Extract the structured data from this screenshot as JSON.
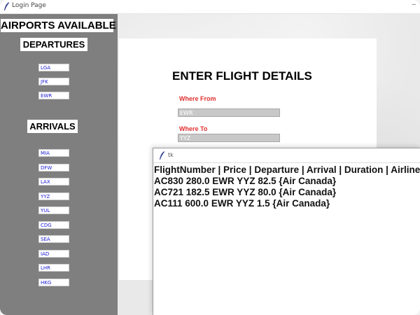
{
  "window": {
    "title": "Login Page",
    "minimize_glyph": "–",
    "icon": "feather-icon"
  },
  "sidebar": {
    "heading": "AIRPORTS AVAILABLE",
    "departures_heading": "DEPARTURES",
    "departures": [
      "LGA",
      "JFK",
      "EWR"
    ],
    "arrivals_heading": "ARRIVALS",
    "arrivals": [
      "MIA",
      "DFW",
      "LAX",
      "YYZ",
      "YUL",
      "CDG",
      "SEA",
      "IAD",
      "LHR",
      "HKG"
    ]
  },
  "form": {
    "title": "ENTER FLIGHT DETAILS",
    "from_label": "Where From",
    "from_value": "EWR",
    "to_label": "Where To",
    "to_value": "YYZ"
  },
  "results_window": {
    "title": "tk",
    "icon": "feather-icon",
    "lines": [
      "FlightNumber | Price | Departure | Arrival | Duration | Airline",
      "AC830 280.0 EWR YYZ 82.5 {Air Canada}",
      "AC721 182.5 EWR YYZ 80.0 {Air Canada}",
      "AC111 600.0 EWR YYZ 1.5 {Air Canada}"
    ]
  },
  "colors": {
    "sidebar_bg": "#7f7f7f",
    "label_red": "#e03030",
    "airport_text_blue": "#1a1ad6",
    "field_bg": "#c8c8c8"
  }
}
